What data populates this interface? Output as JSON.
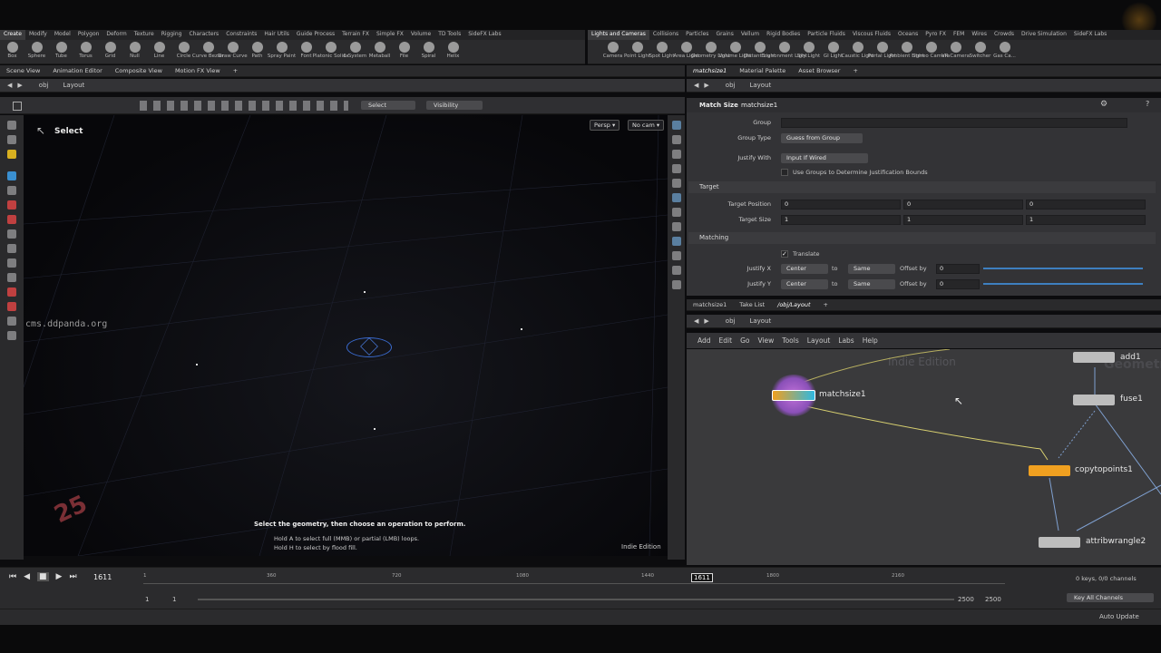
{
  "shelf_left": {
    "tabs": [
      "Create",
      "Modify",
      "Model",
      "Polygon",
      "Deform",
      "Texture",
      "Rigging",
      "Characters",
      "Constraints",
      "Hair Utils",
      "Guide Process",
      "Terrain FX",
      "Simple FX",
      "Volume",
      "TD Tools",
      "SideFX Labs"
    ],
    "tools": [
      "Box",
      "Sphere",
      "Tube",
      "Torus",
      "Grid",
      "Null",
      "Line",
      "Circle",
      "Curve Bezier",
      "Draw Curve",
      "Path",
      "Spray Paint",
      "Font",
      "Platonic Solids",
      "L-System",
      "Metaball",
      "File",
      "Spiral",
      "Helix"
    ]
  },
  "shelf_right": {
    "tabs": [
      "Lights and Cameras",
      "Collisions",
      "Particles",
      "Grains",
      "Vellum",
      "Rigid Bodies",
      "Particle Fluids",
      "Viscous Fluids",
      "Oceans",
      "Pyro FX",
      "FEM",
      "Wires",
      "Crowds",
      "Drive Simulation",
      "SideFX Labs"
    ],
    "tools": [
      "Camera",
      "Point Light",
      "Spot Light",
      "Area Light",
      "Geometry Light",
      "Volume Light",
      "Distant Light",
      "Environment Light",
      "Sky Light",
      "GI Light",
      "Caustic Light",
      "Portal Light",
      "Ambient Light",
      "Stereo Camera",
      "VR Camera",
      "Switcher",
      "Gas Ca..."
    ]
  },
  "left_pane": {
    "tabs": [
      "Scene View",
      "Animation Editor",
      "Composite View",
      "Motion FX View"
    ],
    "path": {
      "root": "obj",
      "current": "Layout"
    },
    "toolbar": {
      "select_menu": "Select",
      "visibility_menu": "Visibility"
    },
    "viewport": {
      "tool_name": "Select",
      "persp_button": "Persp ▾",
      "cam_button": "No cam ▾",
      "watermark": "cms.ddpanda.org",
      "hint_title": "Select the geometry, then choose an operation to perform.",
      "hint_line1": "Hold A to select full (MMB) or partial (LMB) loops.",
      "hint_line2": "Hold H to select by flood fill.",
      "edition": "Indie Edition",
      "grid_number": "25"
    }
  },
  "param_pane": {
    "tabs": [
      "matchsize1",
      "Material Palette",
      "Asset Browser"
    ],
    "path": {
      "root": "obj",
      "current": "Layout"
    },
    "node_type": "Match Size",
    "node_name": "matchsize1",
    "rows": {
      "group_label": "Group",
      "group_value": "",
      "group_type_label": "Group Type",
      "group_type_value": "Guess from Group",
      "justify_with_label": "Justify With",
      "justify_with_value": "Input If Wired",
      "use_groups_label": "Use Groups to Determine Justification Bounds",
      "target_section": "Target",
      "target_position_label": "Target Position",
      "target_position": [
        "0",
        "0",
        "0"
      ],
      "target_size_label": "Target Size",
      "target_size": [
        "1",
        "1",
        "1"
      ],
      "matching_section": "Matching",
      "translate_label": "Translate",
      "justify_x_label": "Justify X",
      "justify_x_value": "Center",
      "justify_x_to": "Same",
      "justify_x_offset": "0",
      "justify_y_label": "Justify Y",
      "justify_y_value": "Center",
      "justify_y_to": "Same",
      "justify_y_offset": "0",
      "to_label": "to",
      "offset_label": "Offset by"
    }
  },
  "network_pane": {
    "tabs": [
      "matchsize1",
      "Take List",
      "/obj/Layout"
    ],
    "path": {
      "root": "obj",
      "current": "Layout"
    },
    "menu": [
      "Add",
      "Edit",
      "Go",
      "View",
      "Tools",
      "Layout",
      "Labs",
      "Help"
    ],
    "watermark_edition": "Indie Edition",
    "watermark_context": "Geometry",
    "nodes": [
      "add1",
      "fuse1",
      "matchsize1",
      "copytopoints1",
      "attribwrangle2"
    ]
  },
  "timeline": {
    "current_frame": "1611",
    "ticks": [
      "1",
      "360",
      "720",
      "1080",
      "1440",
      "1800",
      "2160"
    ],
    "marker": "1611",
    "range_start": "1",
    "range_start2": "1",
    "range_end": "2500",
    "range_end2": "2500",
    "keys_info": "0 keys, 0/0 channels",
    "key_channels": "Key All Channels",
    "auto_update": "Auto Update"
  },
  "colors": {
    "accent_orange": "#f0a020",
    "select_cyan": "#2fb8e0",
    "node_gray": "#bdbdbd"
  }
}
